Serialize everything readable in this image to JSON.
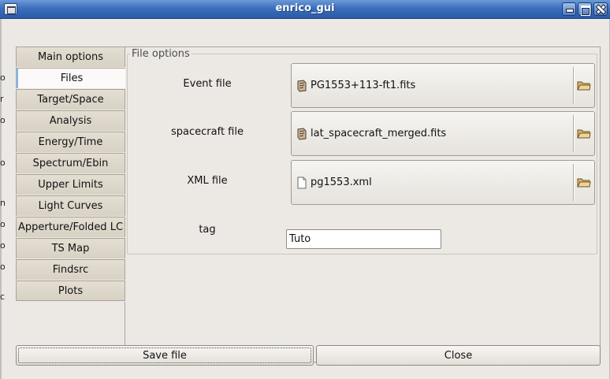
{
  "window": {
    "title": "enrico_gui"
  },
  "tabs": [
    {
      "label": "Main options"
    },
    {
      "label": "Files",
      "active": true
    },
    {
      "label": "Target/Space"
    },
    {
      "label": "Analysis"
    },
    {
      "label": "Energy/Time"
    },
    {
      "label": "Spectrum/Ebin"
    },
    {
      "label": "Upper Limits"
    },
    {
      "label": "Light Curves"
    },
    {
      "label": "Apperture/Folded LC"
    },
    {
      "label": "TS Map"
    },
    {
      "label": "Findsrc"
    },
    {
      "label": "Plots"
    }
  ],
  "file_options": {
    "group_label": "File options",
    "event_file": {
      "label": "Event file",
      "value": "PG1553+113-ft1.fits",
      "icon": "fits-file-icon"
    },
    "spacecraft_file": {
      "label": "spacecraft file",
      "value": "lat_spacecraft_merged.fits",
      "icon": "fits-file-icon"
    },
    "xml_file": {
      "label": "XML file",
      "value": "pg1553.xml",
      "icon": "text-file-icon"
    },
    "tag": {
      "label": "tag",
      "value": "Tuto"
    }
  },
  "buttons": {
    "save": "Save file",
    "close": "Close"
  },
  "colors": {
    "titlebar": "#3c6fbd",
    "window_bg": "#ece9e4",
    "active_tab_accent": "#8eb2e3"
  }
}
